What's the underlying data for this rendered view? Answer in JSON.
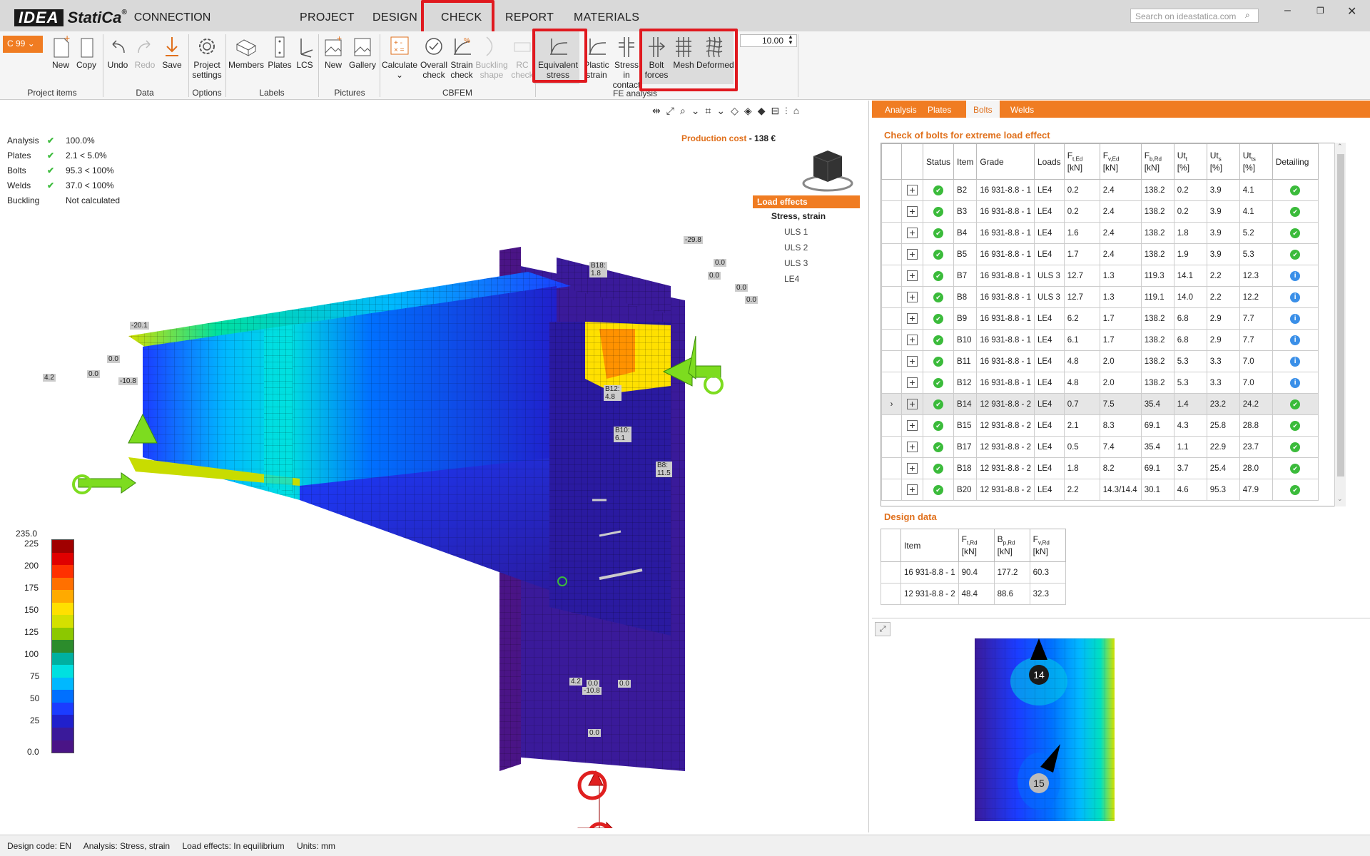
{
  "app": {
    "logo_idea": "IDEA",
    "logo_statica": "StatiCa",
    "logo_reg": "®",
    "product": "CONNECTION",
    "menu_tabs": [
      "PROJECT",
      "DESIGN",
      "CHECK",
      "REPORT",
      "MATERIALS"
    ],
    "active_tab": "CHECK",
    "search_placeholder": "Search on ideastatica.com",
    "window_controls": [
      "–",
      "❐",
      "✕"
    ]
  },
  "ribbon": {
    "selector": "C 99",
    "zoom_value": "10.00",
    "buttons": {
      "new": "New",
      "copy": "Copy",
      "undo": "Undo",
      "redo": "Redo",
      "save": "Save",
      "project_settings_1": "Project",
      "project_settings_2": "settings",
      "members": "Members",
      "plates": "Plates",
      "lcs": "LCS",
      "pic_new": "New",
      "gallery": "Gallery",
      "calculate": "Calculate",
      "overall_1": "Overall",
      "overall_2": "check",
      "strain_1": "Strain",
      "strain_2": "check",
      "buckling_1": "Buckling",
      "buckling_2": "shape",
      "rc_1": "RC",
      "rc_2": "check",
      "equiv_1": "Equivalent",
      "equiv_2": "stress",
      "plastic_1": "Plastic",
      "plastic_2": "strain",
      "stressin_1": "Stress in",
      "stressin_2": "contact",
      "boltforces_1": "Bolt",
      "boltforces_2": "forces",
      "mesh": "Mesh",
      "deformed": "Deformed"
    },
    "groups": {
      "project_items": "Project items",
      "data": "Data",
      "options": "Options",
      "labels": "Labels",
      "pictures": "Pictures",
      "cbfem": "CBFEM",
      "fe_analysis": "FE analysis"
    }
  },
  "summary": [
    {
      "label": "Analysis",
      "check": "✔",
      "value": "100.0%"
    },
    {
      "label": "Plates",
      "check": "✔",
      "value": "2.1 < 5.0%"
    },
    {
      "label": "Bolts",
      "check": "✔",
      "value": "95.3 < 100%"
    },
    {
      "label": "Welds",
      "check": "✔",
      "value": "37.0 < 100%"
    },
    {
      "label": "Buckling",
      "check": "",
      "value": "Not calculated"
    }
  ],
  "production_cost": {
    "label": "Production cost",
    "value": "- 138 €"
  },
  "load_effects": {
    "header": "Load effects",
    "group": "Stress, strain",
    "items": [
      "ULS 1",
      "ULS 2",
      "ULS 3",
      "LE4"
    ]
  },
  "legend": {
    "values": [
      "235.0",
      "225",
      "200",
      "175",
      "150",
      "125",
      "100",
      "75",
      "50",
      "25",
      "0.0"
    ],
    "colors": [
      "#a00000",
      "#e00000",
      "#ff3000",
      "#ff7000",
      "#ffaa00",
      "#ffe000",
      "#d4e000",
      "#8cc800",
      "#2c8c2c",
      "#00b0a0",
      "#00e0e0",
      "#00b8ff",
      "#0070ff",
      "#1b3cff",
      "#2020cc",
      "#3a1a9a",
      "#4a1486"
    ]
  },
  "model_labels": [
    {
      "text": "-29.8"
    },
    {
      "text": "0.0"
    },
    {
      "text": "0.0"
    },
    {
      "text": "0.0"
    },
    {
      "text": "0.0"
    },
    {
      "text": "-20.1"
    },
    {
      "text": "0.0"
    },
    {
      "text": "4.2"
    },
    {
      "text": "0.0"
    },
    {
      "text": "-10.8"
    },
    {
      "text": "B18: 1.8"
    },
    {
      "text": "B12: 4.8"
    },
    {
      "text": "B10: 6.1"
    },
    {
      "text": "B8: 11.5"
    },
    {
      "text": "4.2"
    },
    {
      "text": "0.0"
    },
    {
      "text": "0.0"
    },
    {
      "text": "-10.8"
    },
    {
      "text": "0.0"
    }
  ],
  "right_tabs": [
    "Analysis",
    "Plates",
    "Bolts",
    "Welds"
  ],
  "right_active_tab": "Bolts",
  "bolts_title": "Check of bolts for extreme load effect",
  "bolt_table": {
    "headers": {
      "status": "Status",
      "item": "Item",
      "grade": "Grade",
      "loads": "Loads",
      "ft_main": "F",
      "ft_sub": "t,Ed",
      "ft_unit": "[kN]",
      "fv_main": "F",
      "fv_sub": "v,Ed",
      "fv_unit": "[kN]",
      "fb_main": "F",
      "fb_sub": "b,Rd",
      "fb_unit": "[kN]",
      "utt_main": "Ut",
      "utt_sub": "t",
      "utt_unit": "[%]",
      "uts_main": "Ut",
      "uts_sub": "s",
      "uts_unit": "[%]",
      "utts_main": "Ut",
      "utts_sub": "ts",
      "utts_unit": "[%]",
      "detailing": "Detailing"
    },
    "rows": [
      {
        "item": "B2",
        "grade": "16 931-8.8 - 1",
        "loads": "LE4",
        "ft": "0.2",
        "fv": "2.4",
        "fb": "138.2",
        "utt": "0.2",
        "uts": "3.9",
        "utts": "4.1",
        "detail": "ok",
        "selected": false
      },
      {
        "item": "B3",
        "grade": "16 931-8.8 - 1",
        "loads": "LE4",
        "ft": "0.2",
        "fv": "2.4",
        "fb": "138.2",
        "utt": "0.2",
        "uts": "3.9",
        "utts": "4.1",
        "detail": "ok",
        "selected": false
      },
      {
        "item": "B4",
        "grade": "16 931-8.8 - 1",
        "loads": "LE4",
        "ft": "1.6",
        "fv": "2.4",
        "fb": "138.2",
        "utt": "1.8",
        "uts": "3.9",
        "utts": "5.2",
        "detail": "ok",
        "selected": false
      },
      {
        "item": "B5",
        "grade": "16 931-8.8 - 1",
        "loads": "LE4",
        "ft": "1.7",
        "fv": "2.4",
        "fb": "138.2",
        "utt": "1.9",
        "uts": "3.9",
        "utts": "5.3",
        "detail": "ok",
        "selected": false
      },
      {
        "item": "B7",
        "grade": "16 931-8.8 - 1",
        "loads": "ULS 3",
        "ft": "12.7",
        "fv": "1.3",
        "fb": "119.3",
        "utt": "14.1",
        "uts": "2.2",
        "utts": "12.3",
        "detail": "info",
        "selected": false
      },
      {
        "item": "B8",
        "grade": "16 931-8.8 - 1",
        "loads": "ULS 3",
        "ft": "12.7",
        "fv": "1.3",
        "fb": "119.1",
        "utt": "14.0",
        "uts": "2.2",
        "utts": "12.2",
        "detail": "info",
        "selected": false
      },
      {
        "item": "B9",
        "grade": "16 931-8.8 - 1",
        "loads": "LE4",
        "ft": "6.2",
        "fv": "1.7",
        "fb": "138.2",
        "utt": "6.8",
        "uts": "2.9",
        "utts": "7.7",
        "detail": "info",
        "selected": false
      },
      {
        "item": "B10",
        "grade": "16 931-8.8 - 1",
        "loads": "LE4",
        "ft": "6.1",
        "fv": "1.7",
        "fb": "138.2",
        "utt": "6.8",
        "uts": "2.9",
        "utts": "7.7",
        "detail": "info",
        "selected": false
      },
      {
        "item": "B11",
        "grade": "16 931-8.8 - 1",
        "loads": "LE4",
        "ft": "4.8",
        "fv": "2.0",
        "fb": "138.2",
        "utt": "5.3",
        "uts": "3.3",
        "utts": "7.0",
        "detail": "info",
        "selected": false
      },
      {
        "item": "B12",
        "grade": "16 931-8.8 - 1",
        "loads": "LE4",
        "ft": "4.8",
        "fv": "2.0",
        "fb": "138.2",
        "utt": "5.3",
        "uts": "3.3",
        "utts": "7.0",
        "detail": "info",
        "selected": false
      },
      {
        "item": "B14",
        "grade": "12 931-8.8 - 2",
        "loads": "LE4",
        "ft": "0.7",
        "fv": "7.5",
        "fb": "35.4",
        "utt": "1.4",
        "uts": "23.2",
        "utts": "24.2",
        "detail": "ok",
        "selected": true
      },
      {
        "item": "B15",
        "grade": "12 931-8.8 - 2",
        "loads": "LE4",
        "ft": "2.1",
        "fv": "8.3",
        "fb": "69.1",
        "utt": "4.3",
        "uts": "25.8",
        "utts": "28.8",
        "detail": "ok",
        "selected": false
      },
      {
        "item": "B17",
        "grade": "12 931-8.8 - 2",
        "loads": "LE4",
        "ft": "0.5",
        "fv": "7.4",
        "fb": "35.4",
        "utt": "1.1",
        "uts": "22.9",
        "utts": "23.7",
        "detail": "ok",
        "selected": false
      },
      {
        "item": "B18",
        "grade": "12 931-8.8 - 2",
        "loads": "LE4",
        "ft": "1.8",
        "fv": "8.2",
        "fb": "69.1",
        "utt": "3.7",
        "uts": "25.4",
        "utts": "28.0",
        "detail": "ok",
        "selected": false
      },
      {
        "item": "B20",
        "grade": "12 931-8.8 - 2",
        "loads": "LE4",
        "ft": "2.2",
        "fv": "14.3/14.4",
        "fb": "30.1",
        "utt": "4.6",
        "uts": "95.3",
        "utts": "47.9",
        "detail": "ok",
        "selected": false
      }
    ]
  },
  "design_title": "Design data",
  "design_table": {
    "headers": {
      "item": "Item",
      "ft_main": "F",
      "ft_sub": "t,Rd",
      "ft_unit": "[kN]",
      "bp_main": "B",
      "bp_sub": "p,Rd",
      "bp_unit": "[kN]",
      "fv_main": "F",
      "fv_sub": "v,Rd",
      "fv_unit": "[kN]"
    },
    "rows": [
      {
        "item": "16 931-8.8 - 1",
        "ft": "90.4",
        "bp": "177.2",
        "fv": "60.3"
      },
      {
        "item": "12 931-8.8 - 2",
        "ft": "48.4",
        "bp": "88.6",
        "fv": "32.3"
      }
    ]
  },
  "detail_view": {
    "bolt_labels": [
      "14",
      "15"
    ]
  },
  "statusbar": {
    "design_code": "Design code: EN",
    "analysis": "Analysis: Stress, strain",
    "load_effects": "Load effects: In equilibrium",
    "units": "Units: mm"
  }
}
